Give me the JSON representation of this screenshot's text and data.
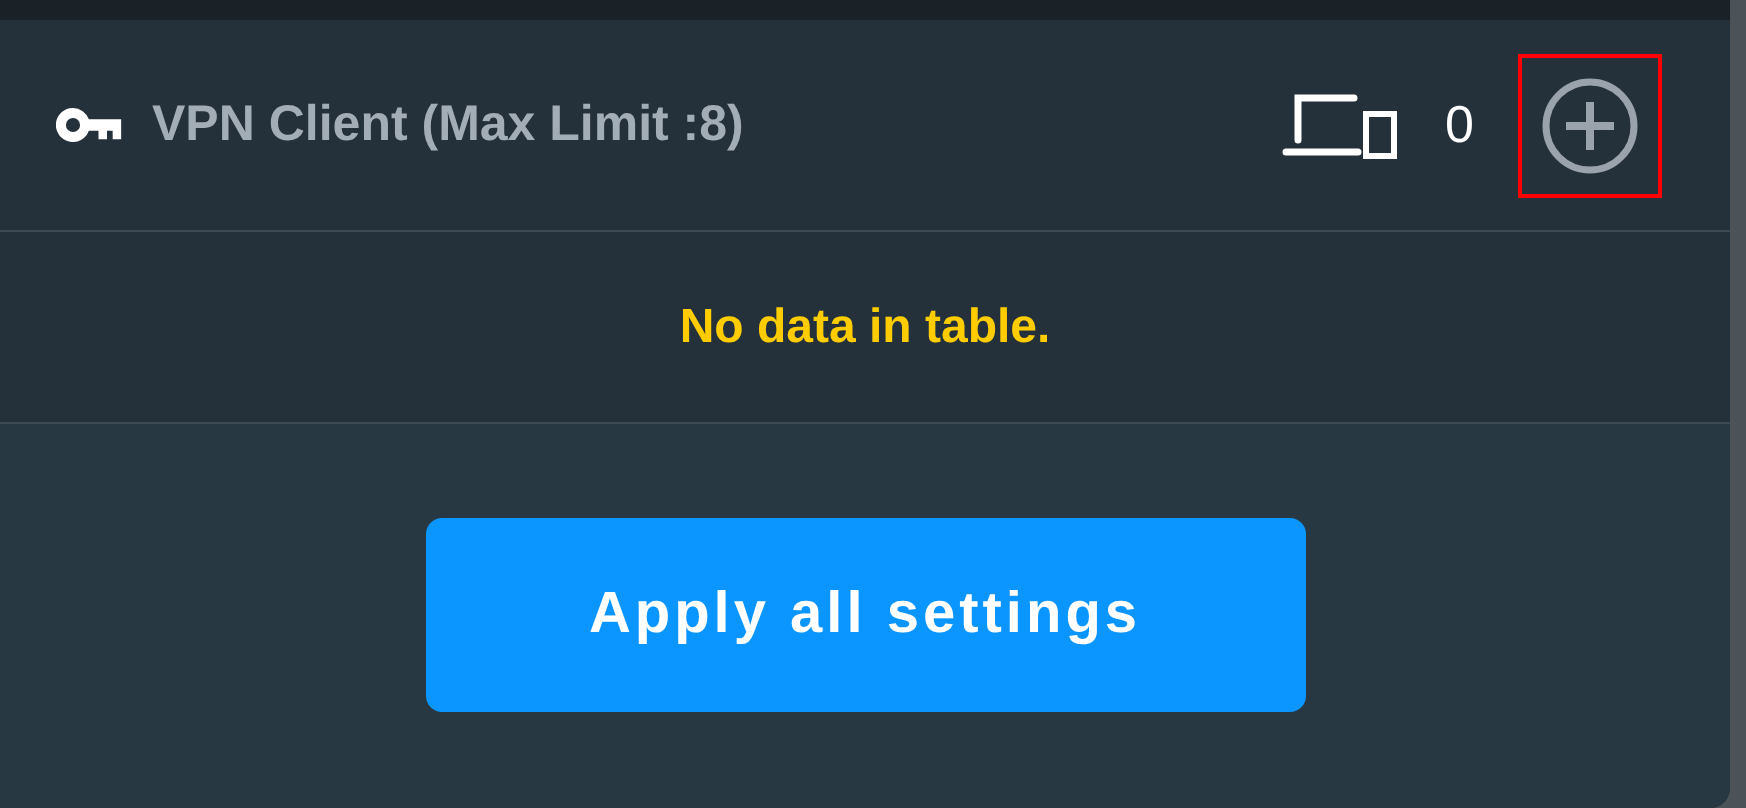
{
  "header": {
    "title": "VPN Client (Max Limit :8)",
    "device_count": "0",
    "add_highlighted": true
  },
  "table": {
    "empty_message": "No data in table."
  },
  "apply_button": {
    "label": "Apply all settings"
  }
}
